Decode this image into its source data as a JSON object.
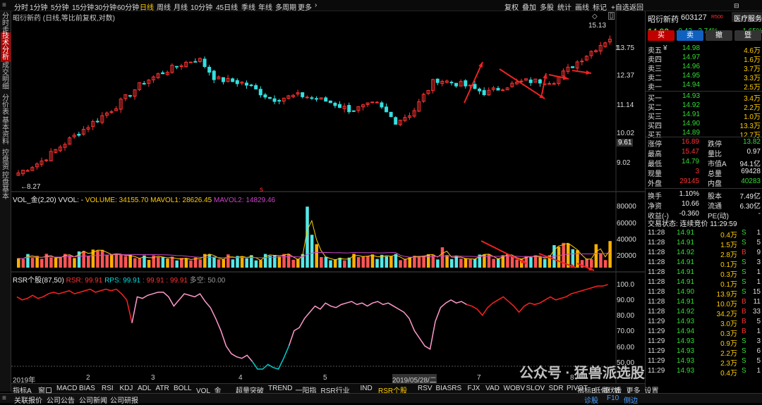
{
  "toolbar": {
    "periods": [
      "分时",
      "1分钟",
      "5分钟",
      "15分钟",
      "30分钟",
      "60分钟",
      "日线",
      "周线",
      "月线",
      "10分钟",
      "45日线",
      "季线",
      "年线",
      "多周期",
      "更多"
    ],
    "active_period": "日线",
    "right_actions": [
      "复权",
      "叠加",
      "多股",
      "统计",
      "画线",
      "标记",
      "+自选",
      "返回"
    ]
  },
  "side_tabs": [
    {
      "label": "分时走势",
      "active": false
    },
    {
      "label": "技术分析",
      "active": true
    },
    {
      "label": "成交明细",
      "active": false
    },
    {
      "label": "分价表",
      "active": false
    },
    {
      "label": "基本资料",
      "active": false
    },
    {
      "label": "控盘资",
      "active": false
    },
    {
      "label": "控盘基本",
      "active": false
    }
  ],
  "chart": {
    "stock_label": "昭衍新药 (日线,等比前复权,对数)",
    "price_axis": [
      "13.75",
      "12.37",
      "11.14",
      "10.02",
      "9.02"
    ],
    "current_price_tag": "9.61",
    "high_marker": "15.13",
    "low_marker": "8.27",
    "right_mini_labels": [
      "1."
    ],
    "volume_legend": {
      "name": "VOL_金(2,20)",
      "vvol": "VVOL: -",
      "volume": "VOLUME: 34155.70",
      "mavol1": "MAVOL1: 28626.45",
      "mavol2": "MAVOL2: 14829.46"
    },
    "volume_axis": [
      "80000",
      "60000",
      "40000",
      "20000"
    ],
    "rsr_legend": {
      "name": "RSR个股(87,50)",
      "rsr": "RSR: 99.91",
      "rps": "RPS: 99.91",
      "v3": ": 99.91",
      "v4": ": 99.91",
      "v5": "多空: 50.00"
    },
    "rsr_axis": [
      "100.0",
      "90.00",
      "80.00",
      "70.00",
      "60.00",
      "50.00"
    ],
    "date_axis": [
      "2019年",
      "2",
      "3",
      "4",
      "5",
      "2019/05/28/二",
      "7",
      "8"
    ],
    "colors": {
      "up": "#ff3333",
      "down": "#33e0e0",
      "ma": "#ffcc00",
      "rsr_red": "#ff2020",
      "rsr_pink": "#ff99cc",
      "rsr_cyan": "#00cccc",
      "arrow": "#ee2222"
    }
  },
  "panel": {
    "name": "昭衍新药",
    "code": "603127",
    "badge": "R500",
    "sector": "医疗服务",
    "price": "14.93",
    "change": "-0.42",
    "change_pct": "-2.74%",
    "sector_pct": "-1.65%",
    "buttons": [
      "买",
      "卖",
      "撤",
      "暨"
    ],
    "asks": [
      {
        "label": "卖五",
        "sym": "¥",
        "price": "14.98",
        "vol": "4.6万"
      },
      {
        "label": "卖四",
        "sym": "",
        "price": "14.97",
        "vol": "1.6万"
      },
      {
        "label": "卖三",
        "sym": "",
        "price": "14.96",
        "vol": "3.7万"
      },
      {
        "label": "卖二",
        "sym": "",
        "price": "14.95",
        "vol": "3.3万"
      },
      {
        "label": "卖一",
        "sym": "",
        "price": "14.94",
        "vol": "2.5万"
      }
    ],
    "bids": [
      {
        "label": "买一",
        "price": "14.93",
        "vol": "3.4万"
      },
      {
        "label": "买二",
        "price": "14.92",
        "vol": "2.2万"
      },
      {
        "label": "买三",
        "price": "14.91",
        "vol": "1.0万"
      },
      {
        "label": "买四",
        "price": "14.90",
        "vol": "13.3万"
      },
      {
        "label": "买五",
        "price": "14.89",
        "vol": "12.7万"
      }
    ],
    "stats": [
      {
        "l1": "涨停",
        "v1": "16.89",
        "c1": "red",
        "l2": "跌停",
        "v2": "13.82",
        "c2": "green"
      },
      {
        "l1": "最高",
        "v1": "15.47",
        "c1": "red",
        "l2": "量比",
        "v2": "0.97",
        "c2": "white"
      },
      {
        "l1": "最低",
        "v1": "14.79",
        "c1": "green",
        "l2": "市值A",
        "v2": "94.1亿",
        "c2": "white"
      },
      {
        "l1": "现量",
        "v1": "3",
        "c1": "red",
        "l2": "总量",
        "v2": "69428",
        "c2": "white"
      },
      {
        "l1": "外盘",
        "v1": "29145",
        "c1": "red",
        "l2": "内盘",
        "v2": "40283",
        "c2": "green"
      }
    ],
    "stats2": [
      {
        "l1": "换手",
        "v1": "1.10%",
        "l2": "股本",
        "v2": "7.49亿"
      },
      {
        "l1": "净资",
        "v1": "10.66",
        "l2": "流通",
        "v2": "6.30亿"
      },
      {
        "l1": "收益(-)",
        "v1": "-0.360",
        "l2": "PE(动)",
        "v2": "-"
      }
    ],
    "trade_status": "交易状态: 连续竞价 11:29:59",
    "ticks": [
      {
        "t": "11:28",
        "p": "14.91",
        "v": "0.4万",
        "d": "S",
        "n": "1"
      },
      {
        "t": "11:28",
        "p": "14.91",
        "v": "1.5万",
        "d": "S",
        "n": "5"
      },
      {
        "t": "11:28",
        "p": "14.92",
        "v": "2.8万",
        "d": "B",
        "n": "9"
      },
      {
        "t": "11:28",
        "p": "14.91",
        "v": "0.1万",
        "d": "S",
        "n": "3"
      },
      {
        "t": "11:28",
        "p": "14.91",
        "v": "0.3万",
        "d": "S",
        "n": "1"
      },
      {
        "t": "11:28",
        "p": "14.91",
        "v": "0.1万",
        "d": "S",
        "n": "1"
      },
      {
        "t": "11:28",
        "p": "14.90",
        "v": "13.9万",
        "d": "S",
        "n": "15"
      },
      {
        "t": "11:28",
        "p": "14.91",
        "v": "10.0万",
        "d": "B",
        "n": "11"
      },
      {
        "t": "11:28",
        "p": "14.92",
        "v": "34.2万",
        "d": "B",
        "n": "33"
      },
      {
        "t": "11:29",
        "p": "14.93",
        "v": "3.0万",
        "d": "B",
        "n": "5"
      },
      {
        "t": "11:29",
        "p": "14.94",
        "v": "0.3万",
        "d": "B",
        "n": "1"
      },
      {
        "t": "11:29",
        "p": "14.93",
        "v": "0.9万",
        "d": "S",
        "n": "3"
      },
      {
        "t": "11:29",
        "p": "14.93",
        "v": "2.2万",
        "d": "S",
        "n": "6"
      },
      {
        "t": "11:29",
        "p": "14.93",
        "v": "2.3万",
        "d": "S",
        "n": "5"
      },
      {
        "t": "11:29",
        "p": "14.93",
        "v": "0.4万",
        "d": "S",
        "n": "1"
      }
    ]
  },
  "bottom_tabs": [
    "指标A",
    "窗口",
    "MACD",
    "BIAS",
    "RSI",
    "KDJ",
    "ADL",
    "ATR",
    "BOLL",
    "VOL_金",
    "超量突破",
    "TREND",
    "一阳指",
    "RSR行业",
    "IND",
    "RSR个股",
    "RSV",
    "BIASRS",
    "FJX",
    "VAD",
    "WOBV",
    "SLOV",
    "SDR",
    "PIVOT",
    "低位伏击",
    "更多",
    "设置",
    "指标B",
    "模",
    "板"
  ],
  "active_bottom_tab": "RSR个股",
  "status_bar": [
    "关联报价",
    "公司公告",
    "公司新闻",
    "公司研报"
  ],
  "status_right": [
    "诊股",
    "F10",
    "侧边"
  ],
  "watermark": "公众号 · 猛兽派选股"
}
